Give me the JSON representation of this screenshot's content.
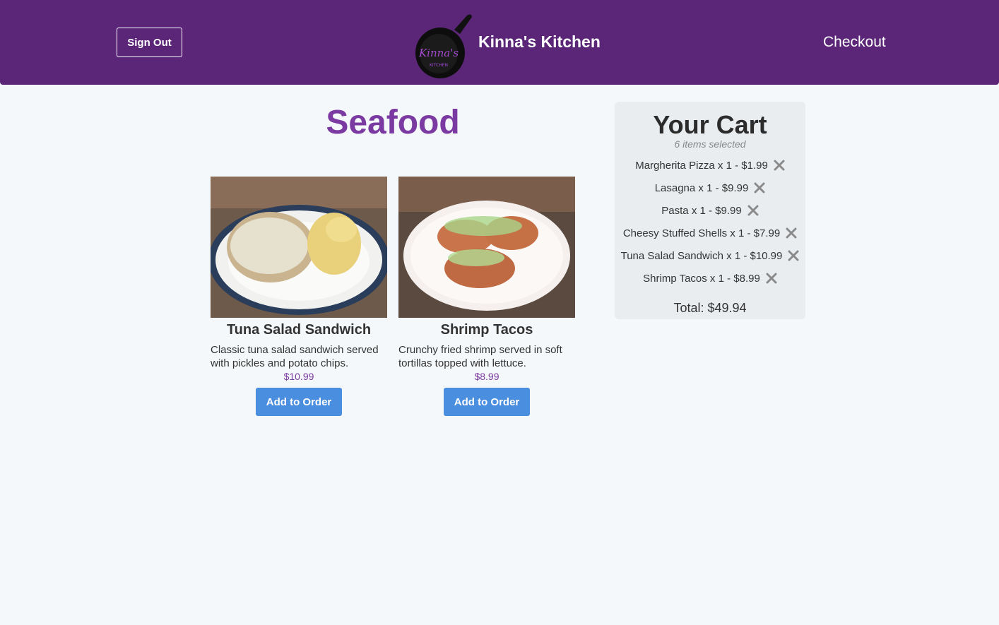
{
  "header": {
    "signout_label": "Sign Out",
    "brand": "Kinna's Kitchen",
    "logo_text": "Kinna's",
    "logo_sub": "KITCHEN",
    "checkout_label": "Checkout",
    "colors": {
      "bar": "#5b2677",
      "accent": "#7b3aa2",
      "button": "#4a8ee0"
    }
  },
  "main": {
    "title": "Seafood",
    "items": [
      {
        "name": "Tuna Salad Sandwich",
        "description": "Classic tuna salad sandwich served with pickles and potato chips.",
        "price": "$10.99",
        "button": "Add to Order"
      },
      {
        "name": "Shrimp Tacos",
        "description": "Crunchy fried shrimp served in soft tortillas topped with lettuce.",
        "price": "$8.99",
        "button": "Add to Order"
      }
    ]
  },
  "cart": {
    "title": "Your Cart",
    "subtitle": "6 items selected",
    "items": [
      "Margherita Pizza x 1 - $1.99",
      "Lasagna x 1 - $9.99",
      "Pasta x 1 - $9.99",
      "Cheesy Stuffed Shells x 1 - $7.99",
      "Tuna Salad Sandwich x 1 - $10.99",
      "Shrimp Tacos x 1 - $8.99"
    ],
    "remove_icon": "close-icon",
    "total": "Total: $49.94"
  }
}
